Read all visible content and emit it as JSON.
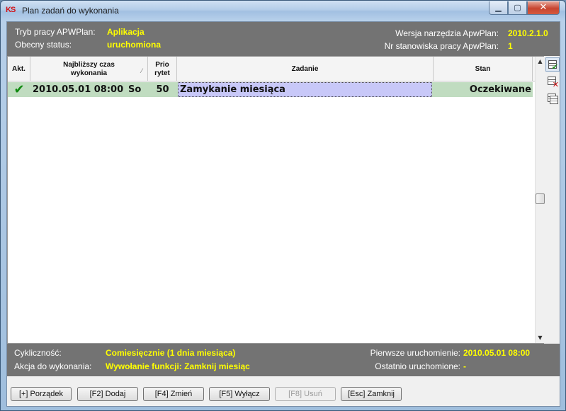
{
  "window": {
    "title": "Plan zadań do wykonania",
    "icon_text": "KS",
    "minimize": "▁",
    "maximize": "▢",
    "close": "✕"
  },
  "header": {
    "mode_label": "Tryb pracy APWPlan:",
    "mode_value": "Aplikacja",
    "status_label": "Obecny status:",
    "status_value": "uruchomiona",
    "version_label": "Wersja narzędzia ApwPlan:",
    "version_value": "2010.2.1.0",
    "station_label": "Nr stanowiska pracy ApwPlan:",
    "station_value": "1"
  },
  "grid": {
    "columns": {
      "active": "Akt.",
      "next_time_line1": "Najbliższy czas",
      "next_time_line2": "wykonania",
      "priority_line1": "Prio",
      "priority_line2": "rytet",
      "task": "Zadanie",
      "state": "Stan"
    },
    "sort_indicator": "⁄",
    "rows": [
      {
        "active_icon": "check-icon",
        "check_glyph": "✔",
        "next_time": "2010.05.01 08:00",
        "day": "So",
        "priority": "50",
        "task": "Zamykanie miesiąca",
        "state": "Oczekiwane"
      }
    ],
    "scroll_up": "▲",
    "scroll_down": "▼"
  },
  "side_tools": [
    {
      "icon": "window-check-icon",
      "mark": "✔",
      "color": "#1a8a1a"
    },
    {
      "icon": "window-delete-icon",
      "mark": "✕",
      "color": "#cc1111"
    },
    {
      "icon": "window-stack-icon",
      "mark": "",
      "color": "#333333"
    }
  ],
  "footer": {
    "cycle_label": "Cykliczność:",
    "cycle_value": "Comiesięcznie (1 dnia miesiąca)",
    "action_label": "Akcja do wykonania:",
    "action_value": "Wywołanie funkcji: Zamknij miesiąc",
    "first_run_label": "Pierwsze uruchomienie:",
    "first_run_value": "2010.05.01 08:00",
    "last_run_label": "Ostatnio uruchomione:",
    "last_run_value": "-"
  },
  "buttons": {
    "order": "[+] Porządek",
    "add": "[F2] Dodaj",
    "edit": "[F4] Zmień",
    "disable": "[F5] Wyłącz",
    "delete": "[F8] Usuń",
    "close": "[Esc] Zamknij"
  },
  "colors": {
    "header_bg": "#737373",
    "value_yellow": "#ffff00",
    "row_green": "#c0dcc0",
    "selected_cell": "#c8c8f8"
  }
}
